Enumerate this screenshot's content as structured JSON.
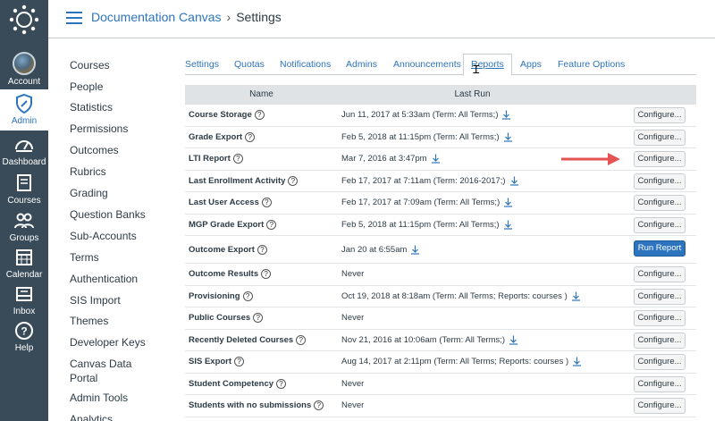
{
  "colors": {
    "nav_bg": "#394b58",
    "accent": "#2d74be",
    "arrow": "#e55353"
  },
  "global_nav": [
    {
      "label": "Account",
      "icon": "avatar"
    },
    {
      "label": "Admin",
      "icon": "shield-icon"
    },
    {
      "label": "Dashboard",
      "icon": "dashboard-icon"
    },
    {
      "label": "Courses",
      "icon": "book-icon"
    },
    {
      "label": "Groups",
      "icon": "groups-icon"
    },
    {
      "label": "Calendar",
      "icon": "calendar-icon"
    },
    {
      "label": "Inbox",
      "icon": "inbox-icon"
    },
    {
      "label": "Help",
      "icon": "help-icon"
    }
  ],
  "breadcrumb": {
    "course": "Documentation Canvas",
    "separator": "›",
    "current": "Settings"
  },
  "course_nav": [
    "Courses",
    "People",
    "Statistics",
    "Permissions",
    "Outcomes",
    "Rubrics",
    "Grading",
    "Question Banks",
    "Sub-Accounts",
    "Terms",
    "Authentication",
    "SIS Import",
    "Themes",
    "Developer Keys",
    "Canvas Data Portal",
    "Admin Tools",
    "Analytics"
  ],
  "tabs": [
    "Settings",
    "Quotas",
    "Notifications",
    "Admins",
    "Announcements",
    "Reports",
    "Apps",
    "Feature Options"
  ],
  "active_tab": "Reports",
  "table": {
    "headers": {
      "name": "Name",
      "last_run": "Last Run"
    },
    "configure_label": "Configure...",
    "run_label": "Run Report",
    "help_glyph": "?",
    "rows": [
      {
        "name": "Course Storage",
        "last_run": "Jun 11, 2017 at 5:33am (Term: All Terms;)",
        "download": true,
        "action": "Configure..."
      },
      {
        "name": "Grade Export",
        "last_run": "Feb 5, 2018 at 11:15pm (Term: All Terms;)",
        "download": true,
        "action": "Configure..."
      },
      {
        "name": "LTI Report",
        "last_run": "Mar 7, 2016 at 3:47pm",
        "download": true,
        "action": "Configure..."
      },
      {
        "name": "Last Enrollment Activity",
        "last_run": "Feb 17, 2017 at 7:11am (Term: 2016-2017;)",
        "download": true,
        "action": "Configure..."
      },
      {
        "name": "Last User Access",
        "last_run": "Feb 17, 2017 at 7:09am (Term: All Terms;)",
        "download": true,
        "action": "Configure..."
      },
      {
        "name": "MGP Grade Export",
        "last_run": "Feb 5, 2018 at 11:15pm (Term: All Terms;)",
        "download": true,
        "action": "Configure..."
      },
      {
        "name": "Outcome Export",
        "last_run": "Jan 20 at 6:55am",
        "download": true,
        "action": "Run Report"
      },
      {
        "name": "Outcome Results",
        "last_run": "Never",
        "download": false,
        "action": "Configure..."
      },
      {
        "name": "Provisioning",
        "last_run": "Oct 19, 2018 at 8:18am (Term: All Terms; Reports: courses )",
        "download": true,
        "action": "Configure..."
      },
      {
        "name": "Public Courses",
        "last_run": "Never",
        "download": false,
        "action": "Configure..."
      },
      {
        "name": "Recently Deleted Courses",
        "last_run": "Nov 21, 2016 at 10:06am (Term: All Terms;)",
        "download": true,
        "action": "Configure..."
      },
      {
        "name": "SIS Export",
        "last_run": "Aug 14, 2017 at 2:11pm (Term: All Terms; Reports: courses )",
        "download": true,
        "action": "Configure..."
      },
      {
        "name": "Student Competency",
        "last_run": "Never",
        "download": false,
        "action": "Configure..."
      },
      {
        "name": "Students with no submissions",
        "last_run": "Never",
        "download": false,
        "action": "Configure..."
      }
    ]
  }
}
